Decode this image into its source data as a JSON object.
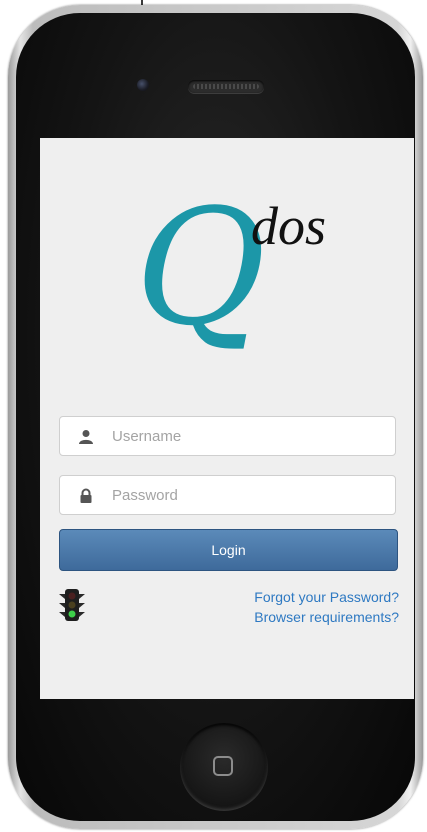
{
  "logo": {
    "letter": "Q",
    "suffix": "dos"
  },
  "login_form": {
    "username_placeholder": "Username",
    "password_placeholder": "Password",
    "login_label": "Login"
  },
  "links": {
    "forgot_password": "Forgot your Password?",
    "browser_requirements": "Browser requirements?"
  },
  "icons": {
    "username": "user-icon",
    "password": "lock-icon",
    "status": "traffic-light-icon",
    "home": "home-button-icon"
  },
  "colors": {
    "logo_q": "#1c97a8",
    "login_button": "#4a77a8",
    "link": "#2e79c2",
    "screen_background": "#efefef"
  }
}
